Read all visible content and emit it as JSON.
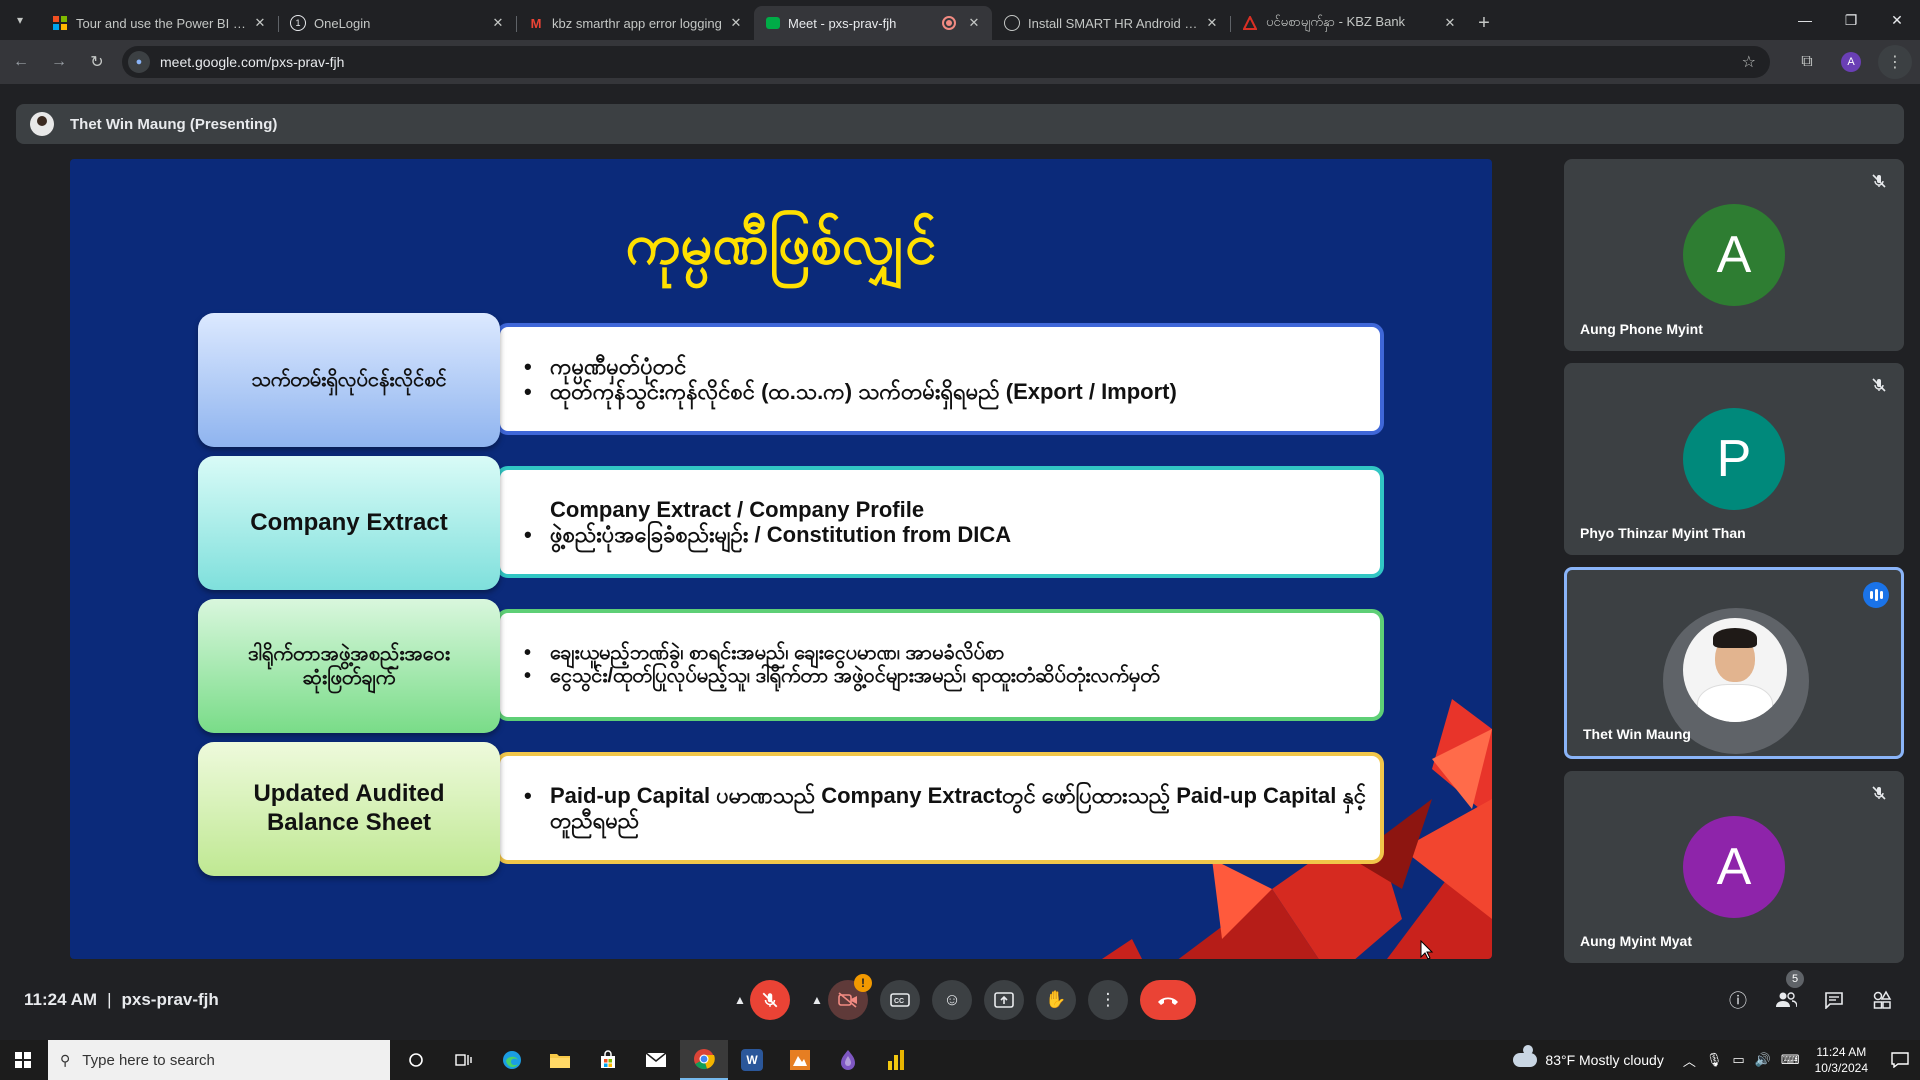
{
  "browser": {
    "tabs": [
      {
        "title": "Tour and use the Power BI servi",
        "favicon": "microsoft-logo",
        "color": "#f25022"
      },
      {
        "title": "OneLogin",
        "favicon": "onelogin-logo",
        "color": "#ffffff"
      },
      {
        "title": "kbz smarthr app error logging",
        "favicon": "gmail-logo",
        "color": "#ea4335"
      },
      {
        "title": "Meet - pxs-prav-fjh",
        "favicon": "meet-logo",
        "color": "#00ac47"
      },
      {
        "title": "Install SMART HR Android app",
        "favicon": "globe-icon",
        "color": "#c4c7c5"
      },
      {
        "title": "ပင်မစာမျက်နှာ - KBZ Bank",
        "favicon": "kbz-logo",
        "color": "#d93025"
      }
    ],
    "url": "meet.google.com/pxs-prav-fjh",
    "profile_initial": "A"
  },
  "meet": {
    "presenter_label": "Thet Win Maung (Presenting)",
    "slide": {
      "title": "ကုမ္ပဏီဖြစ်လျှင်",
      "rows": [
        {
          "label": "သက်တမ်းရှိလုပ်ငန်းလိုင်စင်",
          "bullets": [
            "ကုမ္ပဏီမှတ်ပုံတင်",
            "ထုတ်ကုန်သွင်းကုန်လိုင်စင် (ထ.သ.က) သက်တမ်းရှိရမည် (Export / Import)"
          ]
        },
        {
          "label": "Company Extract",
          "bullets": [
            "Company Extract / Company Profile",
            "ဖွဲ့စည်းပုံအခြေခံစည်းမျဉ်း / Constitution from DICA"
          ]
        },
        {
          "label": "ဒါရိုက်တာအဖွဲ့အစည်းအဝေး ဆုံးဖြတ်ချက်",
          "bullets": [
            "ချေးယူမည့်ဘဏ်ခွဲ၊ စာရင်းအမည်၊ ချေးငွေပမာဏ၊ အာမခံလိပ်စာ",
            "ငွေသွင်း/ထုတ်ပြုလုပ်မည့်သူ၊ ဒါရိုက်တာ အဖွဲ့ဝင်များအမည်၊ ရာထူးတံဆိပ်တုံးလက်မှတ်"
          ]
        },
        {
          "label": "Updated Audited Balance Sheet",
          "bullets": [
            "Paid-up Capital ပမာဏသည် Company Extractတွင် ဖော်ပြထားသည့် Paid-up Capital နှင့် တူညီရမည်"
          ]
        }
      ]
    },
    "participants": [
      {
        "name": "Aung Phone Myint",
        "initial": "A",
        "color": "#2e7d32",
        "muted": true
      },
      {
        "name": "Phyo Thinzar Myint Than",
        "initial": "P",
        "color": "#00897b",
        "muted": true
      },
      {
        "name": "Thet Win Maung",
        "initial": "",
        "color": "#5f6368",
        "muted": false,
        "speaking": true
      },
      {
        "name": "Aung Myint Myat",
        "initial": "A",
        "color": "#8e24aa",
        "muted": true
      }
    ],
    "time": "11:24 AM",
    "separator": "|",
    "meeting_code": "pxs-prav-fjh",
    "camera_alert": "!",
    "people_count": "5"
  },
  "taskbar": {
    "search_placeholder": "Type here to search",
    "weather": "83°F  Mostly cloudy",
    "clock_time": "11:24 AM",
    "clock_date": "10/3/2024"
  }
}
